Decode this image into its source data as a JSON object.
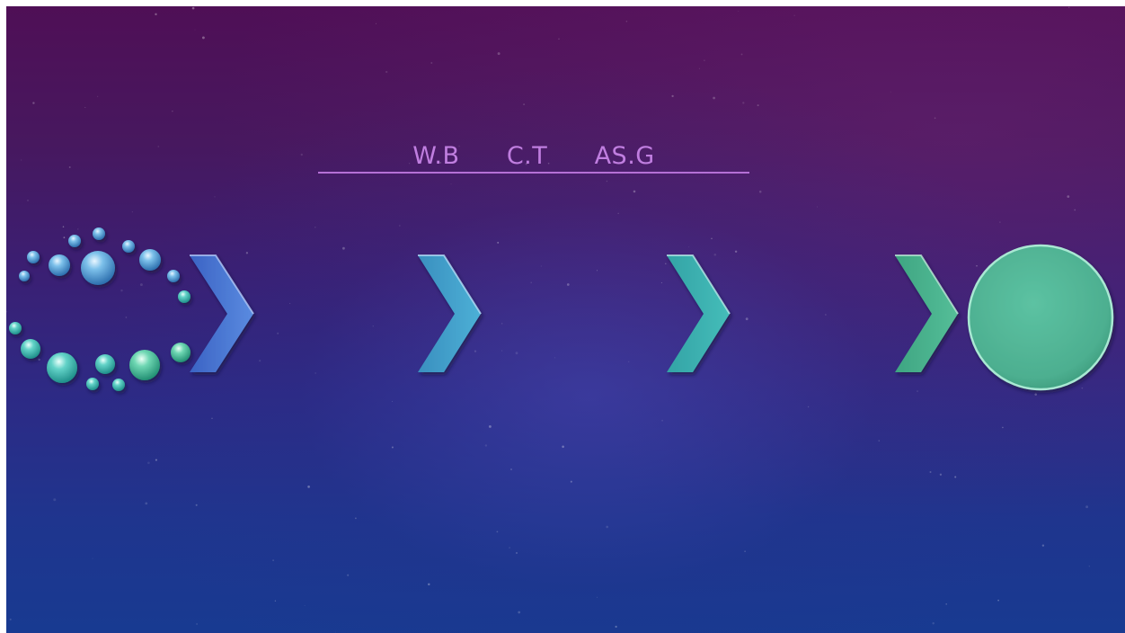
{
  "slide": {
    "title": "W.B    C.T    AS.G"
  },
  "colors": {
    "background_top": "#4f0f56",
    "background_bottom": "#183a91",
    "title": "#c07ee0",
    "underline": "#b570d6",
    "chevron_1": "#4a78d6",
    "chevron_2": "#3f9fc9",
    "chevron_3": "#3bb1b0",
    "chevron_4": "#49b38d",
    "circle": "#52b597",
    "dots_blue": "#5aa6da",
    "dots_teal": "#3fc4bd"
  },
  "icons": [
    "dot-ring-icon",
    "chevron-right-icon",
    "chevron-right-icon",
    "chevron-right-icon",
    "chevron-right-icon",
    "circle-icon"
  ]
}
